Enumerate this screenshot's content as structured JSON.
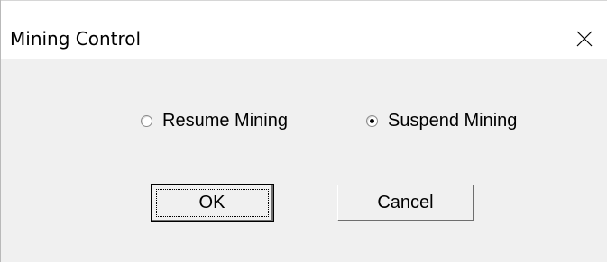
{
  "window": {
    "title": "Mining Control",
    "close_icon": "close-icon"
  },
  "options": {
    "resume": {
      "label": "Resume Mining",
      "selected": false
    },
    "suspend": {
      "label": "Suspend Mining",
      "selected": true
    }
  },
  "buttons": {
    "ok_label": "OK",
    "cancel_label": "Cancel"
  }
}
